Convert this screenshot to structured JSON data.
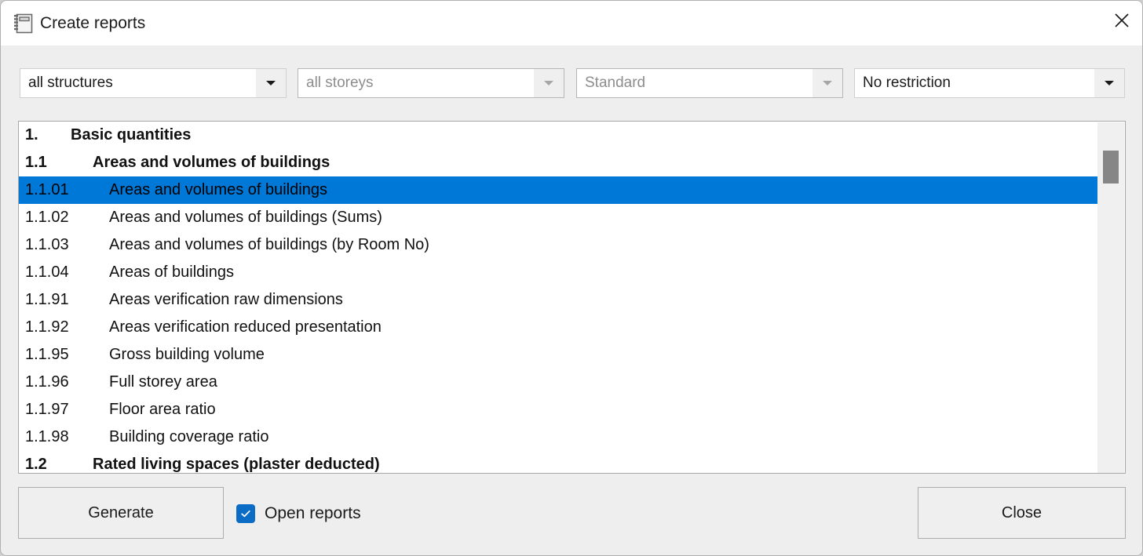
{
  "window": {
    "title": "Create reports",
    "icon": "notebook-icon",
    "close_label": "✕"
  },
  "filters": [
    {
      "id": "structures",
      "value": "all structures",
      "enabled": true
    },
    {
      "id": "storeys",
      "value": "all storeys",
      "enabled": false
    },
    {
      "id": "standard",
      "value": "Standard",
      "enabled": false
    },
    {
      "id": "restriction",
      "value": "No restriction",
      "enabled": true
    }
  ],
  "report_list": {
    "selected_index": 2,
    "rows": [
      {
        "level": "h1",
        "number": "1.",
        "label": "Basic quantities"
      },
      {
        "level": "h2",
        "number": "1.1",
        "label": "Areas and volumes of buildings"
      },
      {
        "level": "item",
        "number": "1.1.01",
        "label": "Areas and volumes of buildings"
      },
      {
        "level": "item",
        "number": "1.1.02",
        "label": "Areas and volumes of buildings (Sums)"
      },
      {
        "level": "item",
        "number": "1.1.03",
        "label": "Areas and volumes of buildings (by Room No)"
      },
      {
        "level": "item",
        "number": "1.1.04",
        "label": "Areas of buildings"
      },
      {
        "level": "item",
        "number": "1.1.91",
        "label": "Areas verification raw dimensions"
      },
      {
        "level": "item",
        "number": "1.1.92",
        "label": "Areas verification reduced presentation"
      },
      {
        "level": "item",
        "number": "1.1.95",
        "label": "Gross building volume"
      },
      {
        "level": "item",
        "number": "1.1.96",
        "label": "Full storey area"
      },
      {
        "level": "item",
        "number": "1.1.97",
        "label": "Floor area ratio"
      },
      {
        "level": "item",
        "number": "1.1.98",
        "label": "Building coverage ratio"
      },
      {
        "level": "h2",
        "number": "1.2",
        "label": "Rated living spaces (plaster deducted)"
      }
    ]
  },
  "footer": {
    "generate_label": "Generate",
    "open_reports_label": "Open reports",
    "open_reports_checked": true,
    "close_label": "Close"
  },
  "colors": {
    "selection": "#0078d7",
    "checkbox": "#0a6cc4",
    "window_body": "#eeeeee",
    "titlebar": "#ffffff"
  }
}
